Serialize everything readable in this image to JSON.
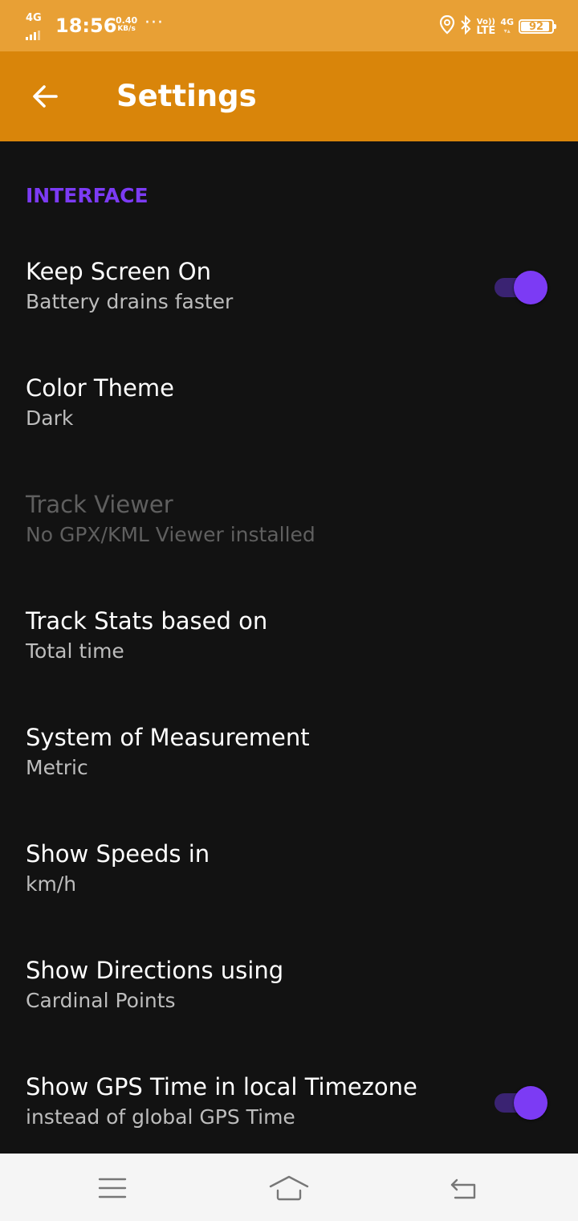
{
  "status_bar": {
    "network": "4G",
    "time": "18:56",
    "speed_value": "0.40",
    "speed_unit": "KB/s",
    "more": "···",
    "volte_top": "Vo))",
    "volte_bottom": "LTE",
    "net2": "4G",
    "battery": "92",
    "battery_level_percent": 92,
    "icons": [
      "signal-icon",
      "location-icon",
      "bluetooth-icon",
      "battery-icon"
    ]
  },
  "app_bar": {
    "title": "Settings",
    "back_icon": "arrow-back-icon",
    "color": "#D9850A"
  },
  "colors": {
    "accent": "#7C3BF4",
    "background": "#121212",
    "status_bar": "#E8A035"
  },
  "section": {
    "header": "INTERFACE"
  },
  "prefs": [
    {
      "title": "Keep Screen On",
      "summary": "Battery drains faster",
      "switch_on": true
    },
    {
      "title": "Color Theme",
      "summary": "Dark"
    },
    {
      "title": "Track Viewer",
      "summary": "No GPX/KML Viewer installed",
      "disabled": true
    },
    {
      "title": "Track Stats based on",
      "summary": "Total time"
    },
    {
      "title": "System of Measurement",
      "summary": "Metric"
    },
    {
      "title": "Show Speeds in",
      "summary": "km/h"
    },
    {
      "title": "Show Directions using",
      "summary": "Cardinal Points"
    },
    {
      "title": "Show GPS Time in local Timezone",
      "summary": "instead of global GPS Time",
      "switch_on": true
    }
  ],
  "nav_bar": {
    "icons": [
      "menu-icon",
      "home-icon",
      "back-icon"
    ]
  }
}
